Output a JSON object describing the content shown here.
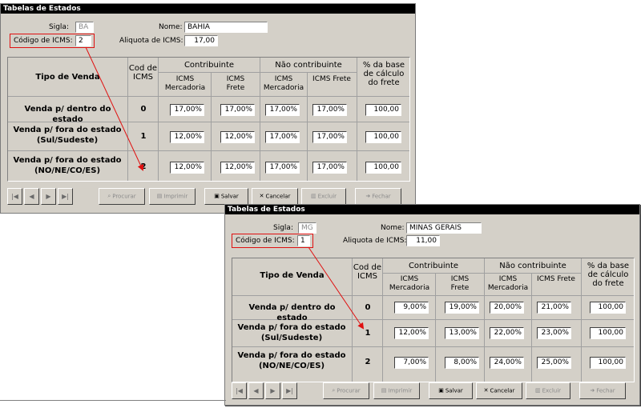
{
  "windows": [
    {
      "title": "Tabelas de Estados",
      "sigla_label": "Sigla:",
      "sigla": "BA",
      "nome_label": "Nome:",
      "nome": "BAHIA",
      "codigo_label": "Código de ICMS:",
      "codigo": "2",
      "aliquota_label": "Aliquota de ICMS:",
      "aliquota": "17,00",
      "headers": {
        "tipo_venda": "Tipo de Venda",
        "cod_icms": "Cod de ICMS",
        "contribuinte": "Contribuinte",
        "nao_contribuinte": "Não contribuinte",
        "base_calc": "% da base de cálculo do frete",
        "icms_mercadoria": "ICMS Mercadoria",
        "icms_frete": "ICMS Frete"
      },
      "rows": [
        {
          "label": "Venda p/ dentro do estado",
          "cod": "0",
          "c_merc": "17,00%",
          "c_frete": "17,00%",
          "nc_merc": "17,00%",
          "nc_frete": "17,00%",
          "base": "100,00"
        },
        {
          "label": "Venda p/ fora do estado (Sul/Sudeste)",
          "cod": "1",
          "c_merc": "12,00%",
          "c_frete": "12,00%",
          "nc_merc": "17,00%",
          "nc_frete": "17,00%",
          "base": "100,00"
        },
        {
          "label": "Venda p/ fora do estado (NO/NE/CO/ES)",
          "cod": "2",
          "c_merc": "12,00%",
          "c_frete": "12,00%",
          "nc_merc": "17,00%",
          "nc_frete": "17,00%",
          "base": "100,00"
        }
      ],
      "buttons": {
        "procurar": "Procurar",
        "imprimir": "Imprimir",
        "salvar": "Salvar",
        "cancelar": "Cancelar",
        "excluir": "Excluir",
        "fechar": "Fechar"
      }
    },
    {
      "title": "Tabelas de Estados",
      "sigla_label": "Sigla:",
      "sigla": "MG",
      "nome_label": "Nome:",
      "nome": "MINAS GERAIS",
      "codigo_label": "Código de ICMS:",
      "codigo": "1",
      "aliquota_label": "Aliquota de ICMS:",
      "aliquota": "11,00",
      "headers": {
        "tipo_venda": "Tipo de Venda",
        "cod_icms": "Cod de ICMS",
        "contribuinte": "Contribuinte",
        "nao_contribuinte": "Não contribuinte",
        "base_calc": "% da base de cálculo do frete",
        "icms_mercadoria": "ICMS Mercadoria",
        "icms_frete": "ICMS Frete"
      },
      "rows": [
        {
          "label": "Venda p/ dentro do estado",
          "cod": "0",
          "c_merc": "9,00%",
          "c_frete": "19,00%",
          "nc_merc": "20,00%",
          "nc_frete": "21,00%",
          "base": "100,00"
        },
        {
          "label": "Venda p/ fora do estado (Sul/Sudeste)",
          "cod": "1",
          "c_merc": "12,00%",
          "c_frete": "13,00%",
          "nc_merc": "22,00%",
          "nc_frete": "23,00%",
          "base": "100,00"
        },
        {
          "label": "Venda p/ fora do estado (NO/NE/CO/ES)",
          "cod": "2",
          "c_merc": "7,00%",
          "c_frete": "8,00%",
          "nc_merc": "24,00%",
          "nc_frete": "25,00%",
          "base": "100,00"
        }
      ],
      "buttons": {
        "procurar": "Procurar",
        "imprimir": "Imprimir",
        "salvar": "Salvar",
        "cancelar": "Cancelar",
        "excluir": "Excluir",
        "fechar": "Fechar"
      }
    }
  ],
  "colors": {
    "window_bg": "#d4d0c8",
    "titlebar": "#000000",
    "highlight": "#e01010"
  },
  "icons": [
    "first-record-icon",
    "prev-record-icon",
    "next-record-icon",
    "last-record-icon",
    "binoculars-icon",
    "printer-icon",
    "floppy-disk-icon",
    "cancel-x-icon",
    "trash-icon",
    "exit-icon"
  ]
}
